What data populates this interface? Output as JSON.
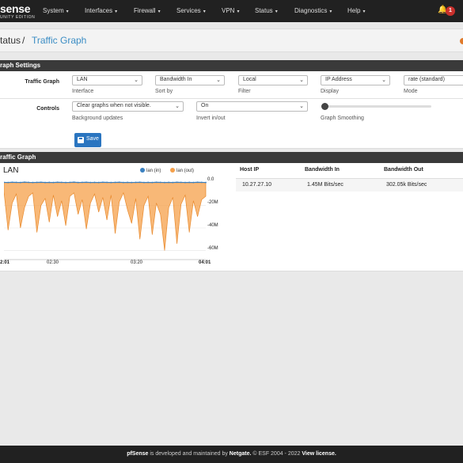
{
  "brand": {
    "logo": "sense",
    "tagline": "UNITY EDITION"
  },
  "nav": [
    {
      "label": "System",
      "icon": "chevron-down-icon"
    },
    {
      "label": "Interfaces",
      "icon": "chevron-down-icon"
    },
    {
      "label": "Firewall",
      "icon": "chevron-down-icon"
    },
    {
      "label": "Services",
      "icon": "chevron-down-icon"
    },
    {
      "label": "VPN",
      "icon": "chevron-down-icon"
    },
    {
      "label": "Status",
      "icon": "chevron-down-icon"
    },
    {
      "label": "Diagnostics",
      "icon": "chevron-down-icon"
    },
    {
      "label": "Help",
      "icon": "chevron-down-icon"
    }
  ],
  "notifications": {
    "count": "1",
    "icon": "bell-icon",
    "color": "#c9302c"
  },
  "breadcrumb": {
    "parent": "tatus",
    "separator": "/",
    "current": "Traffic Graph"
  },
  "settings": {
    "title": "raph Settings",
    "traffic_graph_label": "Traffic Graph",
    "controls_label": "Controls",
    "interface": {
      "value": "LAN",
      "help": "Interface"
    },
    "sort_by": {
      "value": "Bandwidth In",
      "help": "Sort by"
    },
    "filter": {
      "value": "Local",
      "help": "Filter"
    },
    "display": {
      "value": "IP Address",
      "help": "Display"
    },
    "mode": {
      "value": "rate (standard)",
      "help": "Mode"
    },
    "background": {
      "value": "Clear graphs when not visible.",
      "help": "Background updates"
    },
    "invert": {
      "value": "On",
      "help": "Invert in/out"
    },
    "smoothing": {
      "help": "Graph Smoothing",
      "value": 0
    },
    "save_label": "Save",
    "save_icon": "save-icon"
  },
  "graph_panel": {
    "title": "raffic Graph"
  },
  "chart_data": {
    "type": "area",
    "title": "LAN",
    "series": [
      {
        "name": "lan (in)",
        "color": "#3a80c0",
        "values": [
          0.3,
          0.2,
          0.4,
          0.3,
          0.2,
          0.5,
          0.3,
          0.2,
          0.3,
          0.4,
          0.2,
          0.3,
          0.2,
          0.4,
          0.3,
          0.2,
          0.3,
          0.5,
          0.2,
          0.3,
          0.4,
          0.2,
          0.3,
          0.2,
          0.4,
          0.3,
          0.2,
          0.3,
          0.4,
          0.2,
          0.3,
          0.2,
          0.3,
          0.4,
          0.2,
          0.3,
          0.2,
          0.4,
          0.3,
          0.2,
          0.3,
          0.2,
          0.4,
          0.3,
          0.2,
          0.3,
          0.2,
          0.4,
          0.3,
          0.2
        ]
      },
      {
        "name": "lan (out)",
        "color": "#f5a04a",
        "values": [
          -8,
          -42,
          -18,
          -10,
          -40,
          -22,
          -12,
          -9,
          -44,
          -20,
          -14,
          -35,
          -11,
          -30,
          -16,
          -38,
          -12,
          -9,
          -28,
          -15,
          -41,
          -18,
          -10,
          -26,
          -13,
          -33,
          -11,
          -45,
          -17,
          -9,
          -24,
          -36,
          -14,
          -50,
          -20,
          -12,
          -46,
          -18,
          -28,
          -60,
          -22,
          -13,
          -54,
          -19,
          -11,
          -44,
          -16,
          -30,
          -15,
          -12
        ]
      }
    ],
    "y_ticks": [
      "0.0",
      "-20M",
      "-40M",
      "-60M"
    ],
    "ylim": [
      -68,
      2
    ],
    "x_ticks": [
      "2:01",
      "02:30",
      "03:20",
      "04:01"
    ],
    "legend": "top-right"
  },
  "host_table": {
    "columns": [
      "Host IP",
      "Bandwidth In",
      "Bandwidth Out"
    ],
    "rows": [
      {
        "host": "10.27.27.10",
        "in": "1.45M Bits/sec",
        "out": "302.05k Bits/sec"
      }
    ]
  },
  "footer": {
    "prefix": "pfSense",
    "middle": "is developed and maintained by",
    "company": "Netgate.",
    "copy": "© ESF 2004 - 2022",
    "license": "View license."
  }
}
